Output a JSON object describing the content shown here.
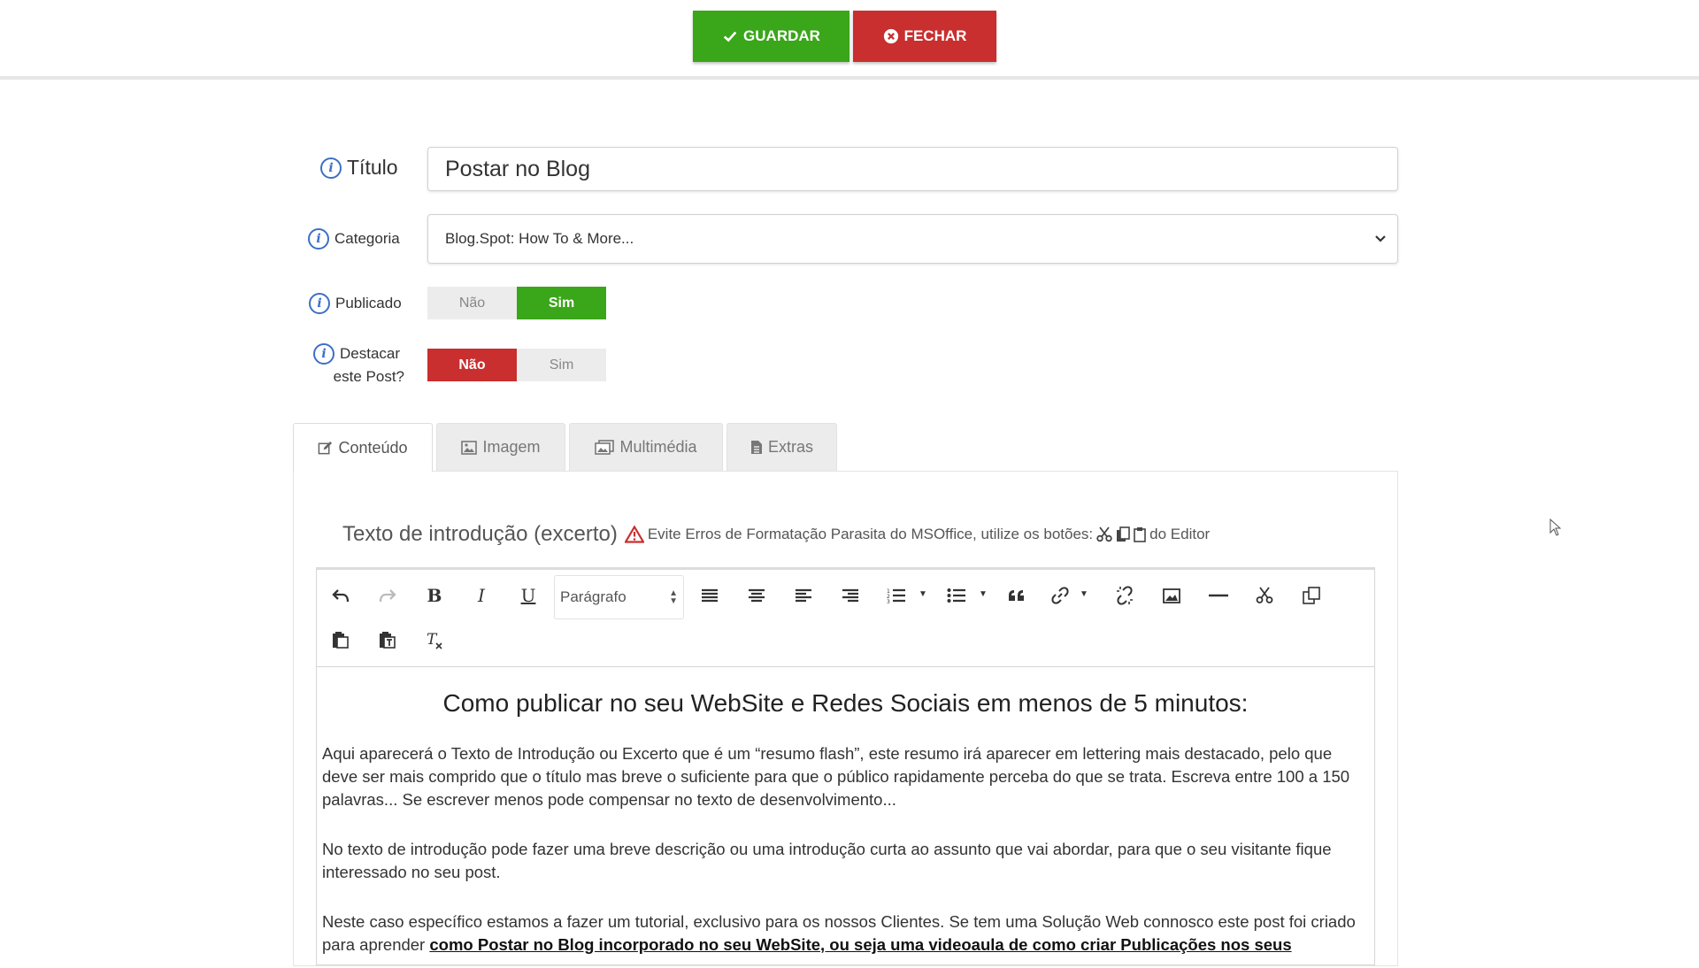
{
  "toolbar": {
    "save_label": "GUARDAR",
    "close_label": "FECHAR"
  },
  "form": {
    "title_label": "Título",
    "title_value": "Postar no Blog",
    "category_label": "Categoria",
    "category_value": "Blog.Spot: How To & More...",
    "published_label": "Publicado",
    "published_no": "Não",
    "published_yes": "Sim",
    "featured_label_1": "Destacar",
    "featured_label_2": "este Post?",
    "featured_no": "Não",
    "featured_yes": "Sim"
  },
  "tabs": [
    {
      "label": "Conteúdo"
    },
    {
      "label": "Imagem"
    },
    {
      "label": "Multimédia"
    },
    {
      "label": "Extras"
    }
  ],
  "excerpt": {
    "title": "Texto de introdução (excerto)",
    "warning_pre": "Evite Erros de Formatação Parasita do MSOffice, utilize os botões:",
    "warning_post": "do Editor"
  },
  "editor": {
    "format_select": "Parágrafo",
    "heading": "Como publicar no seu WebSite e  Redes Sociais em menos de 5 minutos:",
    "para1": "Aqui aparecerá o Texto de  Introdução ou  Excerto que é um “resumo flash”, este resumo irá aparecer em lettering mais destacado, pelo que deve ser mais comprido que o título mas breve o suficiente para que o público rapidamente perceba do que se trata.  Escreva entre 100 a 150 palavras... Se escrever menos pode compensar no texto de desenvolvimento...",
    "para2": "No texto de introdução pode fazer uma breve descrição ou uma introdução curta ao assunto que vai abordar, para que o seu visitante fique interessado no seu post.",
    "para3_plain": "Neste caso específico estamos a fazer um tutorial, exclusivo para os nossos Clientes. Se tem uma Solução Web connosco este post foi criado para aprender ",
    "para3_bold": "como  Postar no  Blog incorporado no seu WebSite, ou seja uma videoaula de como criar  Publicações nos seus"
  }
}
